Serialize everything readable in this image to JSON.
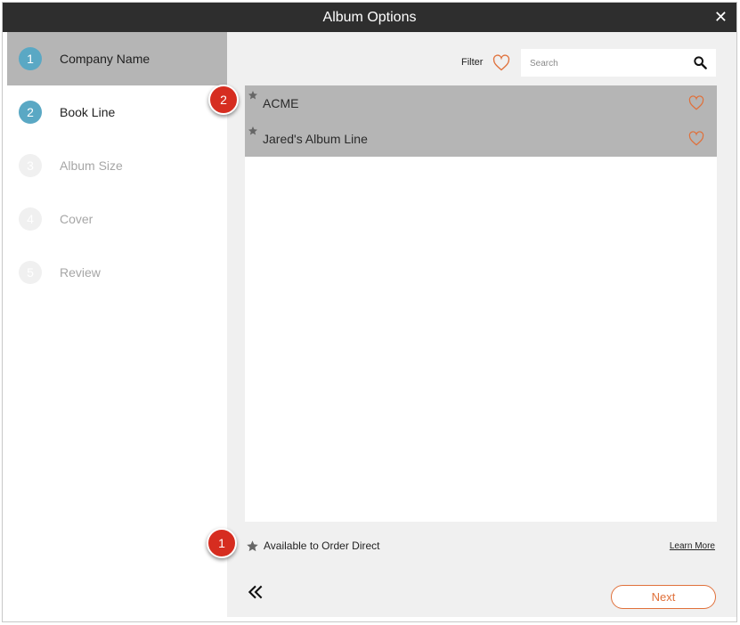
{
  "window": {
    "title": "Album Options",
    "close_glyph": "✕"
  },
  "steps": [
    {
      "number": "1",
      "label": "Company Name"
    },
    {
      "number": "2",
      "label": "Book Line"
    },
    {
      "number": "3",
      "label": "Album Size"
    },
    {
      "number": "4",
      "label": "Cover"
    },
    {
      "number": "5",
      "label": "Review"
    }
  ],
  "toolbar": {
    "filter_label": "Filter",
    "search_placeholder": "Search"
  },
  "book_lines": [
    {
      "name": "ACME"
    },
    {
      "name": "Jared's Album Line"
    }
  ],
  "legend": {
    "text": "Available to Order Direct",
    "learn_more": "Learn More"
  },
  "footer": {
    "next_label": "Next"
  },
  "callouts": [
    {
      "number": "1"
    },
    {
      "number": "2"
    }
  ],
  "icons": {
    "close": "close-icon",
    "heart": "heart-icon",
    "search": "search-icon",
    "star": "star-icon",
    "back": "double-chevron-left-icon"
  },
  "colors": {
    "accent": "#e0703a",
    "step_active": "#5aa8c4",
    "selected_row": "#b5b5b5",
    "title_bar": "#2e2e2e",
    "callout": "#d62d20"
  }
}
